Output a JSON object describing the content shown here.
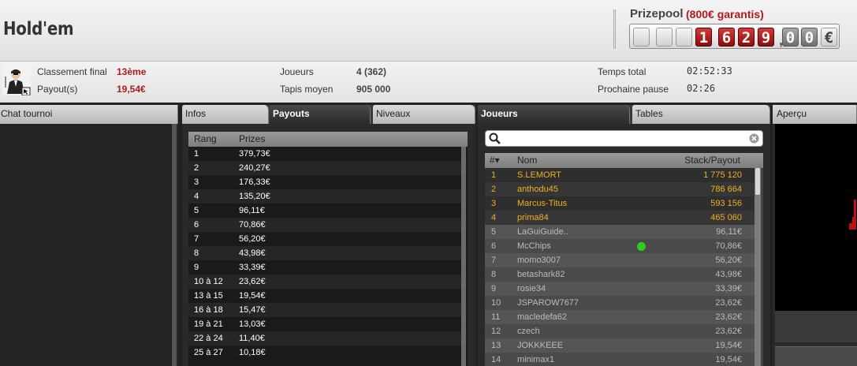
{
  "header": {
    "title": "Hold'em",
    "prizepool_label": "Prizepool",
    "guaranteed": "(800€ garantis)",
    "counter": {
      "digits": [
        "",
        "",
        "",
        "1",
        "6",
        "2",
        "9"
      ],
      "cents": [
        "0",
        "0"
      ],
      "currency": "€"
    }
  },
  "stats": {
    "classement_label": "Classement final",
    "classement_value": "13ème",
    "payout_label": "Payout(s)",
    "payout_value": "19,54€",
    "joueurs_label": "Joueurs",
    "joueurs_value": "4 (362)",
    "tapis_label": "Tapis moyen",
    "tapis_value": "905 000",
    "temps_label": "Temps total",
    "temps_value": "02:52:33",
    "pause_label": "Prochaine pause",
    "pause_value": "02:26"
  },
  "chat": {
    "title": "Chat tournoi"
  },
  "payouts_panel": {
    "tabs": [
      "Infos",
      "Payouts",
      "Niveaux"
    ],
    "active_tab": "Payouts",
    "columns": [
      "Rang",
      "Prizes"
    ],
    "rows": [
      [
        "1",
        "379,73€"
      ],
      [
        "2",
        "240,27€"
      ],
      [
        "3",
        "176,33€"
      ],
      [
        "4",
        "135,20€"
      ],
      [
        "5",
        "96,11€"
      ],
      [
        "6",
        "70,86€"
      ],
      [
        "7",
        "56,20€"
      ],
      [
        "8",
        "43,98€"
      ],
      [
        "9",
        "33,39€"
      ],
      [
        "10 à 12",
        "23,62€"
      ],
      [
        "13 à 15",
        "19,54€"
      ],
      [
        "16 à 18",
        "15,47€"
      ],
      [
        "19 à 21",
        "13,03€"
      ],
      [
        "22 à 24",
        "11,40€"
      ],
      [
        "25 à 27",
        "10,18€"
      ]
    ]
  },
  "players_panel": {
    "tabs": [
      "Joueurs",
      "Tables"
    ],
    "active_tab": "Joueurs",
    "search_placeholder": "",
    "columns": [
      "#▾",
      "Nom",
      "Stack/Payout"
    ],
    "rows": [
      {
        "rank": "1",
        "name": "S.LEMORT",
        "value": "1 775 120",
        "active": true
      },
      {
        "rank": "2",
        "name": "anthodu45",
        "value": "786 664",
        "active": true
      },
      {
        "rank": "3",
        "name": "Marcus-Titus",
        "value": "593 156",
        "active": true
      },
      {
        "rank": "4",
        "name": "prima84",
        "value": "465 060",
        "active": true
      },
      {
        "rank": "5",
        "name": "LaGuiGuide..",
        "value": "96,11€",
        "active": false
      },
      {
        "rank": "6",
        "name": "McChips",
        "value": "70,86€",
        "active": false,
        "online": true
      },
      {
        "rank": "7",
        "name": "momo3007",
        "value": "56,20€",
        "active": false
      },
      {
        "rank": "8",
        "name": "betashark82",
        "value": "43,98€",
        "active": false
      },
      {
        "rank": "9",
        "name": "rosie34",
        "value": "33,39€",
        "active": false
      },
      {
        "rank": "10",
        "name": "JSPAROW7677",
        "value": "23,62€",
        "active": false
      },
      {
        "rank": "11",
        "name": "macledefa62",
        "value": "23,62€",
        "active": false
      },
      {
        "rank": "12",
        "name": "czech",
        "value": "23,62€",
        "active": false
      },
      {
        "rank": "13",
        "name": "JOKKKEEE",
        "value": "19,54€",
        "active": false
      },
      {
        "rank": "14",
        "name": "minimax1",
        "value": "19,54€",
        "active": false
      }
    ]
  },
  "apercu": {
    "title": "Aperçu"
  },
  "colors": {
    "accent_red": "#b01a1a",
    "gold": "#f0b020",
    "online_green": "#2ecc20"
  },
  "icons": {
    "search": "search-icon",
    "clear": "clear-icon",
    "avatar": "avatar-icon"
  }
}
